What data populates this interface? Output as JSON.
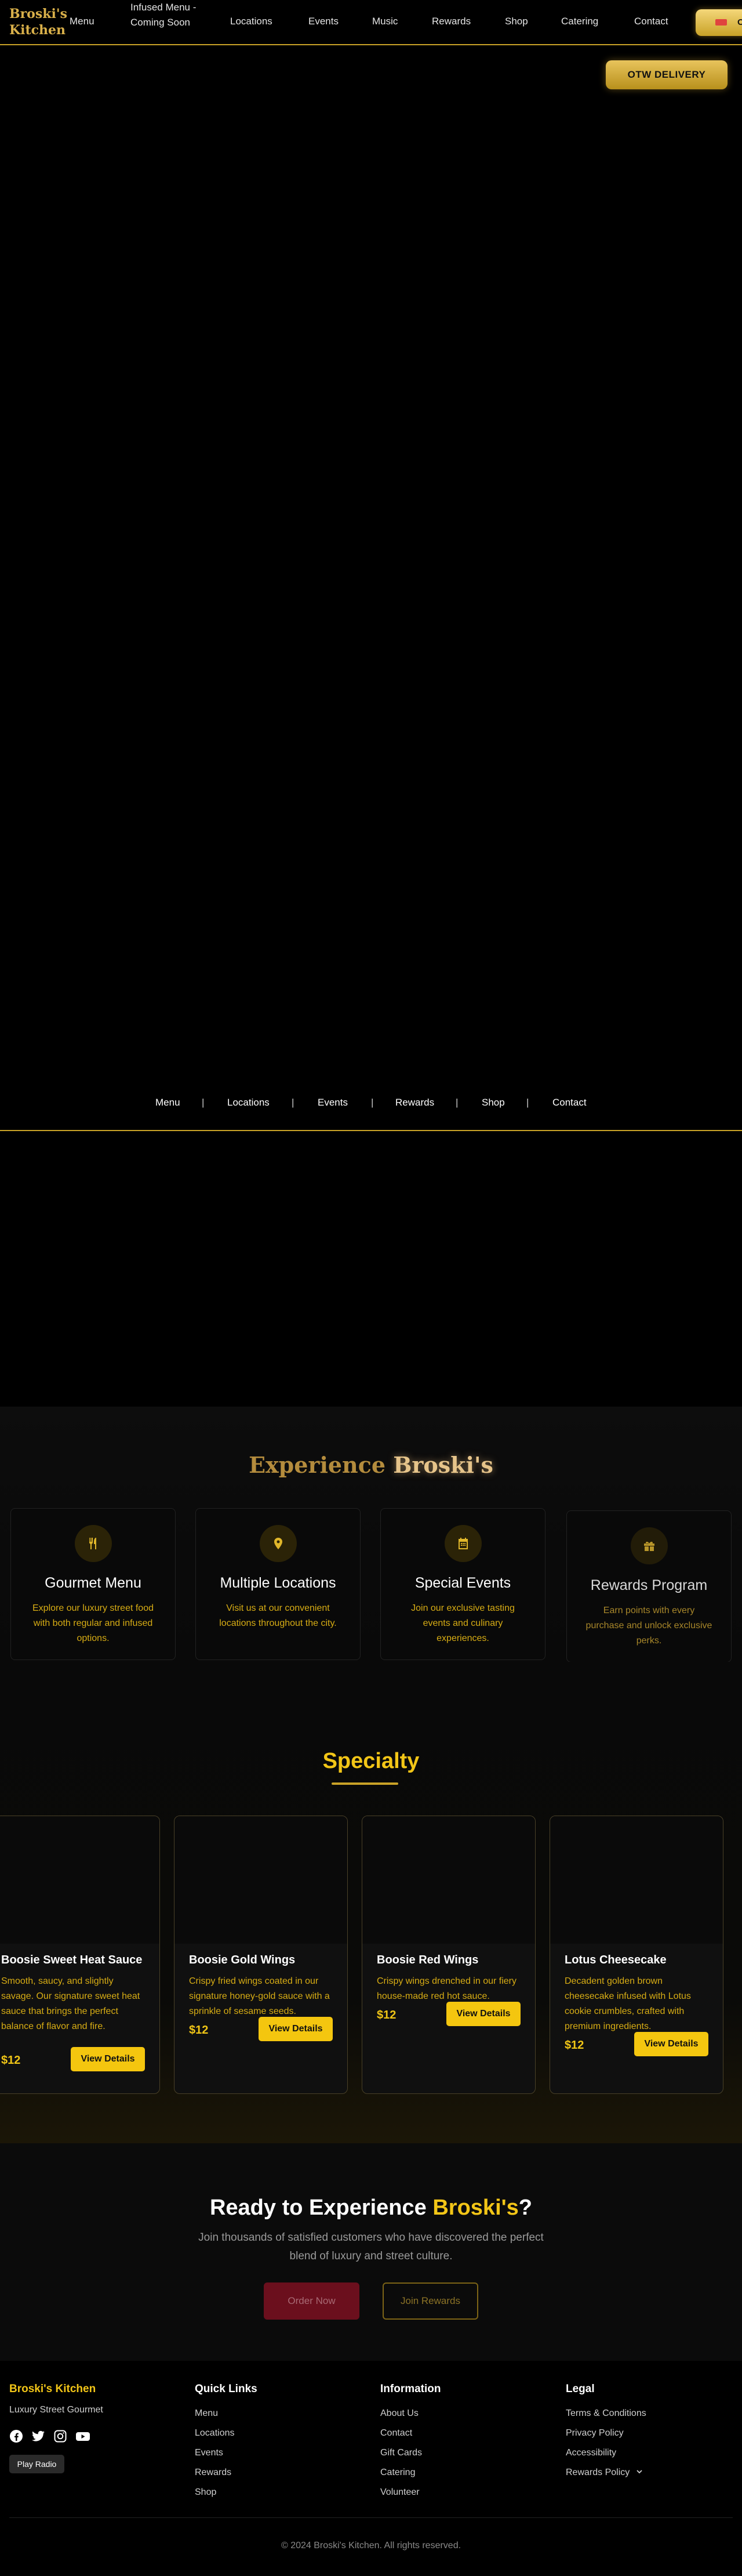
{
  "header": {
    "logo": "Broski's Kitchen",
    "nav": [
      "Menu",
      "Infused Menu - Coming Soon",
      "Locations",
      "Events",
      "Music",
      "Rewards",
      "Shop",
      "Catering",
      "Contact"
    ],
    "otw_cut_label": "O"
  },
  "hero": {
    "otw_button": "OTW DELIVERY"
  },
  "subnav": {
    "items": [
      "Menu",
      "Locations",
      "Events",
      "Rewards",
      "Shop",
      "Contact"
    ],
    "separator": "|"
  },
  "experience": {
    "title_prefix": "Experience",
    "title_highlight": "Broski's",
    "features": [
      {
        "icon": "utensils-icon",
        "title": "Gourmet Menu",
        "text": "Explore our luxury street food with both regular and infused options."
      },
      {
        "icon": "map-pin-icon",
        "title": "Multiple Locations",
        "text": "Visit us at our convenient locations throughout the city."
      },
      {
        "icon": "calendar-icon",
        "title": "Special Events",
        "text": "Join our exclusive tasting events and culinary experiences."
      },
      {
        "icon": "gift-icon",
        "title": "Rewards Program",
        "text": "Earn points with every purchase and unlock exclusive perks."
      }
    ]
  },
  "specialty": {
    "title": "Specialty",
    "button_label": "View Details",
    "items": [
      {
        "name": "Boosie Sweet Heat Sauce",
        "desc": "Smooth, saucy, and slightly savage. Our signature sweet heat sauce that brings the perfect balance of flavor and fire.",
        "price": "$12"
      },
      {
        "name": "Boosie Gold Wings",
        "desc": "Crispy fried wings coated in our signature honey-gold sauce with a sprinkle of sesame seeds.",
        "price": "$12"
      },
      {
        "name": "Boosie Red Wings",
        "desc": "Crispy wings drenched in our fiery house-made red hot sauce.",
        "price": "$12"
      },
      {
        "name": "Lotus Cheesecake",
        "desc": "Decadent golden brown cheesecake infused with Lotus cookie crumbles, crafted with premium ingredients.",
        "price": "$12"
      }
    ]
  },
  "cta": {
    "title_prefix": "Ready to Experience",
    "title_highlight": "Broski's",
    "title_suffix": "?",
    "text": "Join thousands of satisfied customers who have discovered the perfect blend of luxury and street culture.",
    "order_button": "Order Now",
    "join_button": "Join Rewards"
  },
  "footer": {
    "brand": "Broski's Kitchen",
    "tagline": "Luxury Street Gourmet",
    "social_icons": [
      "facebook-icon",
      "twitter-icon",
      "instagram-icon",
      "youtube-icon"
    ],
    "radio_button": "Play Radio",
    "quick_links_title": "Quick Links",
    "quick_links": [
      "Menu",
      "Locations",
      "Events",
      "Rewards",
      "Shop"
    ],
    "info_title": "Information",
    "info_links": [
      "About Us",
      "Contact",
      "Gift Cards",
      "Catering",
      "Volunteer"
    ],
    "legal_title": "Legal",
    "legal_links": [
      "Terms & Conditions",
      "Privacy Policy",
      "Accessibility",
      "Rewards Policy"
    ],
    "copyright": "© 2024 Broski's Kitchen. All rights reserved."
  },
  "colors": {
    "gold": "#f2c517",
    "brand_gold": "#d9b04a",
    "dark": "#000000"
  }
}
